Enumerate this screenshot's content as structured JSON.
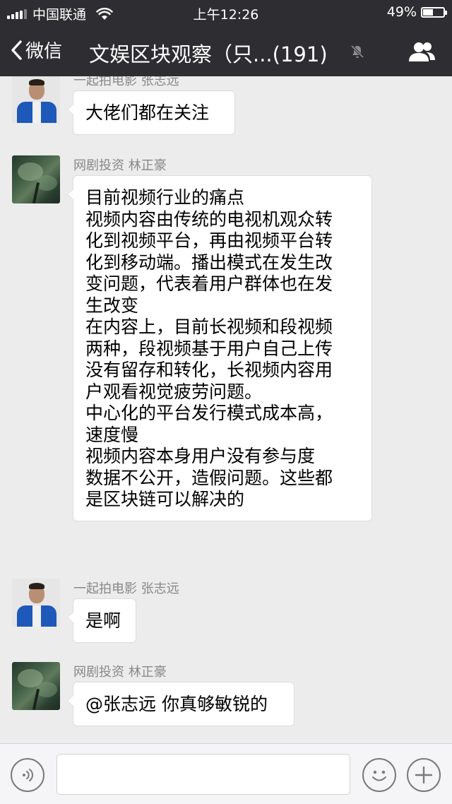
{
  "status_bar": {
    "carrier": "中国联通",
    "time": "上午12:26",
    "battery_percent": "49%",
    "battery_level": 0.49
  },
  "nav": {
    "back_label": "微信",
    "title": "文娱区块观察（只...(191)"
  },
  "messages": [
    {
      "sender": "一起拍电影 张志远",
      "avatar": "man-avatar",
      "lines": [
        "大佬们都在关注"
      ]
    },
    {
      "sender": "网剧投资 林正豪",
      "avatar": "tree-avatar",
      "lines": [
        "目前视频行业的痛点",
        "视频内容由传统的电视机观众转",
        "化到视频平台，再由视频平台转",
        "化到移动端。播出模式在发生改",
        "变问题，代表着用户群体也在发",
        "生改变",
        "在内容上，目前长视频和段视频",
        "两种，段视频基于用户自己上传",
        "没有留存和转化，长视频内容用",
        "户观看视觉疲劳问题。",
        "中心化的平台发行模式成本高，",
        "速度慢",
        "视频内容本身用户没有参与度",
        "数据不公开，造假问题。这些都",
        "是区块链可以解决的"
      ]
    },
    {
      "sender": "一起拍电影 张志远",
      "avatar": "man-avatar",
      "lines": [
        "是啊"
      ]
    },
    {
      "sender": "网剧投资 林正豪",
      "avatar": "tree-avatar",
      "lines": [
        "@张志远 你真够敏锐的"
      ]
    }
  ],
  "input": {
    "value": ""
  },
  "icons": {
    "back": "chevron-left-icon",
    "mute": "mute-bell-icon",
    "group_info": "group-members-icon",
    "voice": "voice-icon",
    "emoji": "emoji-icon",
    "more": "plus-icon"
  },
  "colors": {
    "header_bg": "#2e2e32",
    "chat_bg": "#ececec",
    "bubble_bg": "#ffffff",
    "sender_name": "#888888",
    "input_bar_bg": "#f5f5f7"
  }
}
